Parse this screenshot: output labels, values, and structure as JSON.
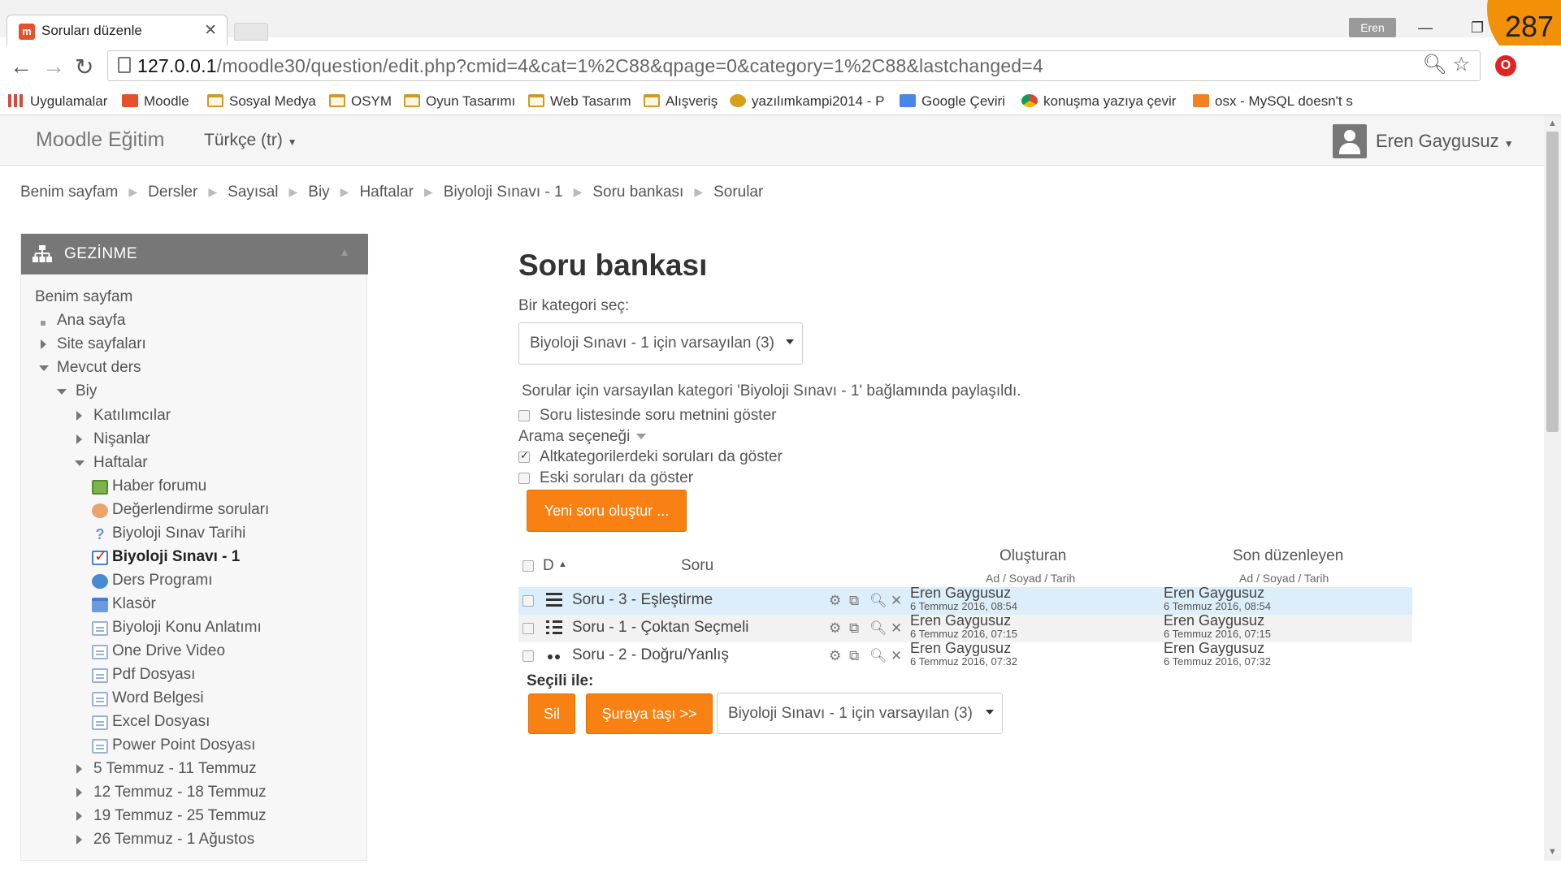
{
  "browser": {
    "tab_title": "Soruları düzenle",
    "tab_favicon": "m",
    "profile_name": "Eren",
    "overlay_number": "287",
    "url_host": "127.0.0.1",
    "url_path": "/moodle30/question/edit.php?cmid=4&cat=1%2C88&qpage=0&category=1%2C88&lastchanged=4",
    "bookmarks": [
      "Uygulamalar",
      "Moodle",
      "Sosyal Medya",
      "OSYM",
      "Oyun Tasarımı",
      "Web Tasarım",
      "Alışveriş",
      "yazılımkampi2014 - P",
      "Google Çeviri",
      "konuşma yazıya çevir",
      "osx - MySQL doesn't s"
    ]
  },
  "navbar": {
    "brand": "Moodle Eğitim",
    "language": "Türkçe (tr)",
    "user": "Eren Gaygusuz"
  },
  "breadcrumb": [
    "Benim sayfam",
    "Dersler",
    "Sayısal",
    "Biy",
    "Haftalar",
    "Biyoloji Sınavı - 1",
    "Soru bankası",
    "Sorular"
  ],
  "sidebar": {
    "title": "GEZİNME",
    "items": [
      "Benim sayfam",
      "Ana sayfa",
      "Site sayfaları",
      "Mevcut ders",
      "Biy",
      "Katılımcılar",
      "Nişanlar",
      "Haftalar",
      "Haber forumu",
      "Değerlendirme soruları",
      "Biyoloji Sınav Tarihi",
      "Biyoloji Sınavı - 1",
      "Ders Programı",
      "Klasör",
      "Biyoloji Konu Anlatımı",
      "One Drive Video",
      "Pdf Dosyası",
      "Word Belgesi",
      "Excel Dosyası",
      "Power Point Dosyası",
      "5 Temmuz - 11 Temmuz",
      "12 Temmuz - 18 Temmuz",
      "19 Temmuz - 25 Temmuz",
      "26 Temmuz - 1 Ağustos"
    ]
  },
  "main": {
    "title": "Soru bankası",
    "category_label": "Bir kategori seç:",
    "category_value": "Biyoloji Sınavı - 1 için varsayılan (3)",
    "shared_notice": "Sorular için varsayılan kategori 'Biyoloji Sınavı - 1' bağlamında paylaşıldı.",
    "show_text_label": "Soru listesinde soru metnini göster",
    "search_options": "Arama seçeneği",
    "subcat_label": "Altkategorilerdeki soruları da göster",
    "old_label": "Eski soruları da göster",
    "new_question_btn": "Yeni soru oluştur ...",
    "table": {
      "col_type": "D",
      "col_question": "Soru",
      "col_created": "Oluşturan",
      "col_created_sub": "Ad / Soyad / Tarih",
      "col_modified": "Son düzenleyen",
      "col_modified_sub": "Ad / Soyad / Tarih",
      "rows": [
        {
          "name": "Soru - 3 - Eşleştirme",
          "type": "matching-icon",
          "creator": "Eren Gaygusuz",
          "created": "6 Temmuz 2016, 08:54",
          "modifier": "Eren Gaygusuz",
          "modified": "6 Temmuz 2016, 08:54"
        },
        {
          "name": "Soru - 1 - Çoktan Seçmeli",
          "type": "multichoice-icon",
          "creator": "Eren Gaygusuz",
          "created": "6 Temmuz 2016, 07:15",
          "modifier": "Eren Gaygusuz",
          "modified": "6 Temmuz 2016, 07:15"
        },
        {
          "name": "Soru - 2 - Doğru/Yanlış",
          "type": "truefalse-icon",
          "creator": "Eren Gaygusuz",
          "created": "6 Temmuz 2016, 07:32",
          "modifier": "Eren Gaygusuz",
          "modified": "6 Temmuz 2016, 07:32"
        }
      ]
    },
    "with_selected": "Seçili ile:",
    "delete_btn": "Sil",
    "move_btn": "Şuraya taşı >>",
    "move_target": "Biyoloji Sınavı - 1 için varsayılan (3)"
  },
  "colors": {
    "accent": "#f98012",
    "header": "#777777",
    "highlight_row": "#dceefa"
  }
}
